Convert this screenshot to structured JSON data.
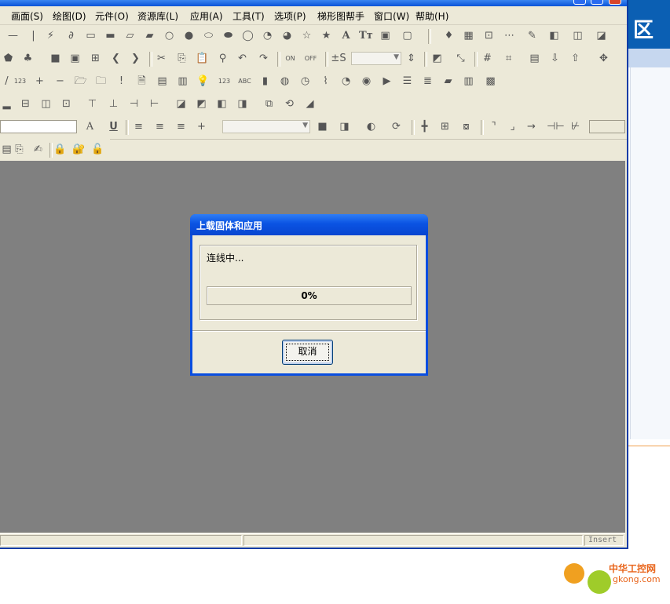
{
  "background": {
    "heading_partial": "区",
    "colors": {
      "blue_band": "#0b5fb3",
      "light_band": "#c6d7ef",
      "divider": "#f0a050"
    }
  },
  "menubar": {
    "items": [
      "画面(S)",
      "绘图(D)",
      "元件(O)",
      "资源库(L)",
      "应用(A)",
      "工具(T)",
      "选项(P)",
      "梯形图帮手",
      "窗口(W)",
      "帮助(H)"
    ]
  },
  "toolbar1": {
    "text_tool_glyph": "A",
    "text_tool2_glyph": "Tт"
  },
  "toolbar2": {
    "on_label": "ON",
    "off_label": "OFF",
    "sign_label": "±S"
  },
  "toolbar3": {
    "num_label": "123",
    "abc_label": "ABC",
    "plus": "+",
    "minus": "−",
    "bang": "!"
  },
  "toolbar5": {
    "font_label": "A",
    "underline_label": "U"
  },
  "statusbar": {
    "insert_mode": "Insert"
  },
  "dialog": {
    "title": "上载固体和应用",
    "status_text": "连线中...",
    "progress_label": "0%",
    "progress_fraction": 0,
    "cancel_label": "取消",
    "colors": {
      "title_bar": "#0a53e3",
      "body": "#ece9d8"
    }
  },
  "watermark": {
    "text_cn": "中华工控网",
    "url": "gkong.com"
  }
}
